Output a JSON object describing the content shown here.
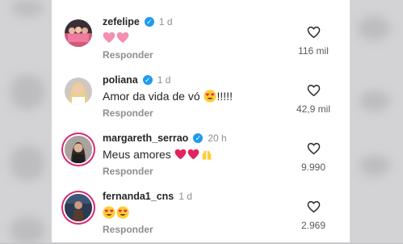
{
  "action_label": "Responder",
  "comments": [
    {
      "username": "zefelipe",
      "time": "1 d",
      "text": "",
      "likes": "116 mil"
    },
    {
      "username": "poliana",
      "time": "1 d",
      "text": "Amor da vida de vó",
      "text_suffix": "!!!!!",
      "likes": "42,9 mil"
    },
    {
      "username": "margareth_serrao",
      "time": "20 h",
      "text": "Meus amores",
      "likes": "9.990"
    },
    {
      "username": "fernanda1_cns",
      "time": "1 d",
      "text": "",
      "likes": "2.969"
    }
  ],
  "icons": {
    "verified": "verified-badge-icon",
    "like": "heart-outline-icon"
  },
  "colors": {
    "verified": "#1d9bf0",
    "story_ring": "#d62976",
    "pink_heart": "#f48fb1",
    "red_heart": "#e0245e"
  }
}
